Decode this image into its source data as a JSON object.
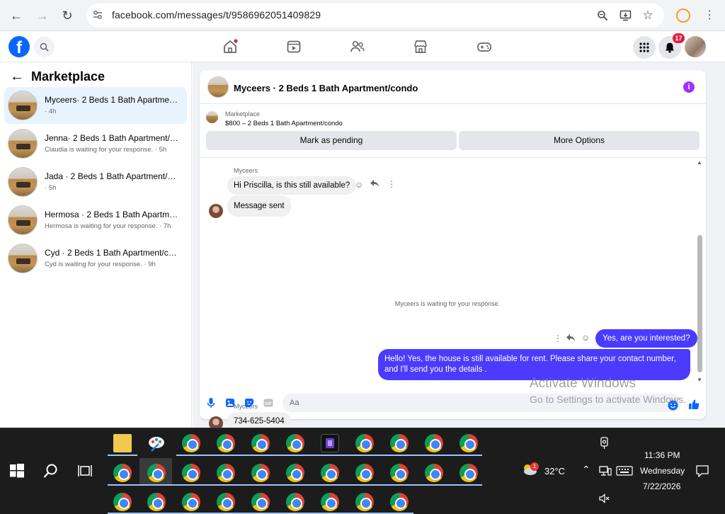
{
  "browser": {
    "url": "facebook.com/messages/t/9586962051409829"
  },
  "fb": {
    "notification_count": "17"
  },
  "sidebar": {
    "title": "Marketplace",
    "conversations": [
      {
        "name": "Myceers· 2 Beds 1 Bath Apartment...",
        "sub": "· 4h"
      },
      {
        "name": "Jenna· 2 Beds 1 Bath Apartment/c...",
        "sub": "Claudia is waiting for your response. · 5h"
      },
      {
        "name": "Jada · 2 Beds 1 Bath Apartment/co...",
        "sub": "· 5h"
      },
      {
        "name": "Hermosa · 2 Beds 1 Bath Apartmen...",
        "sub": "Hermosa is waiting for your response. · 7h"
      },
      {
        "name": "Cyd · 2 Beds 1 Bath Apartment/co...",
        "sub": "Cyd is waiting for your response. · 9h"
      }
    ]
  },
  "chat": {
    "title": "Myceers · 2 Beds 1 Bath Apartment/condo",
    "listing_source": "Marketplace",
    "listing_price": "$800 – 2 Beds 1 Bath Apartment/condo",
    "mark_pending_label": "Mark as pending",
    "more_options_label": "More Options",
    "messages": {
      "sender1": "Myceers",
      "in1": "Hi Priscilla, is this still available?",
      "in2": "Message sent",
      "status": "Myceers is waiting for your response.",
      "out1": "Yes, are you interested?",
      "out2": "Hello! Yes, the house is still available for rent. Please share your contact number, and I'll send you the details .",
      "sender2": "Myceers",
      "in3": "734-625-5404"
    },
    "composer_placeholder": "Aa"
  },
  "watermark": {
    "line1": "Activate Windows",
    "line2": "Go to Settings to activate Windows."
  },
  "taskbar": {
    "weather": "32°C",
    "weather_badge": "1",
    "time": "11:36 PM",
    "day": "Wednesday",
    "date": "7/22/2026"
  },
  "colors": {
    "fb_blue": "#0866ff",
    "outgoing_bubble": "#4b3bff",
    "active_conversation": "#e7f3ff"
  }
}
